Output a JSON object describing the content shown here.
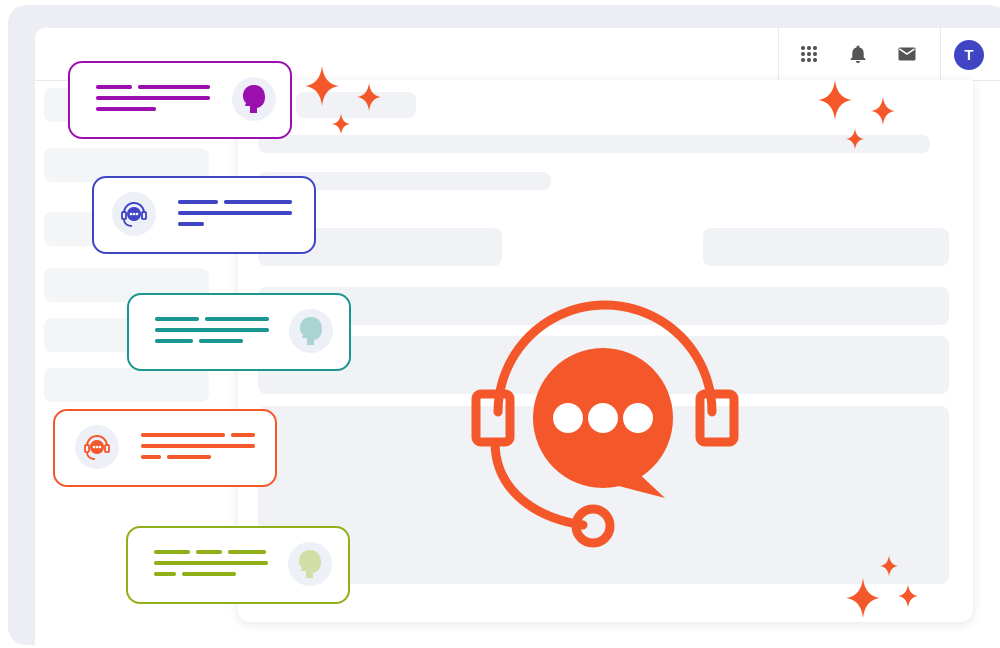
{
  "colors": {
    "accent_orange": "#f4582a",
    "purple": "#9b0fae",
    "indigo": "#3f45c4",
    "teal": "#18968f",
    "lime": "#8fb019",
    "avatar_bg": "#3f45c4"
  },
  "topbar": {
    "icons": [
      "apps-grid-icon",
      "bell-icon",
      "mail-icon"
    ],
    "avatar_initial": "T"
  },
  "hero_icon": "support-headset-chat-icon",
  "chat_bubbles": [
    {
      "color": "purple",
      "avatar_icon": "person-silhouette-icon"
    },
    {
      "color": "indigo",
      "avatar_icon": "support-headset-icon"
    },
    {
      "color": "teal",
      "avatar_icon": "person-silhouette-icon"
    },
    {
      "color": "orange",
      "avatar_icon": "support-headset-icon"
    },
    {
      "color": "lime",
      "avatar_icon": "person-silhouette-icon"
    }
  ],
  "decorations": [
    "sparkle-icon"
  ]
}
